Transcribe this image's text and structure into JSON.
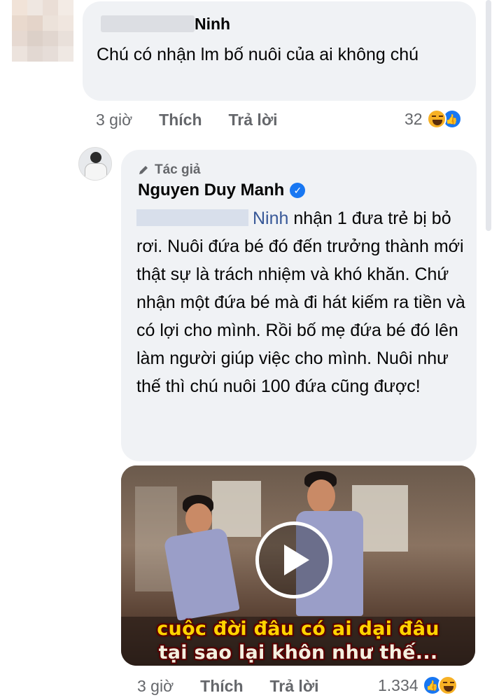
{
  "comment1": {
    "author_suffix": "Ninh",
    "text": "Chú có nhận lm bố nuôi của ai không chú",
    "time": "3 giờ",
    "like_label": "Thích",
    "reply_label": "Trả lời",
    "reaction_count": "32",
    "reaction_icons": [
      "haha-icon",
      "like-icon"
    ]
  },
  "reply": {
    "badge": "Tác giả",
    "author": "Nguyen Duy Manh",
    "verified": true,
    "mention": "Ninh",
    "text": "nhận 1 đưa trẻ bị bỏ rơi. Nuôi đứa bé đó đến trưởng thành mới thật sự là trách nhiệm và khó khăn. Chứ nhận một đứa bé mà đi hát kiếm ra tiền và có lợi cho mình. Rồi bố mẹ đứa bé đó lên làm người giúp việc cho mình. Nuôi như thế thì chú nuôi 100 đứa cũng được!",
    "video": {
      "subtitle_line1": "cuộc đời đâu có ai dại đâu",
      "subtitle_line2": "tại sao lại khôn như thế...",
      "play_icon": "play-icon"
    },
    "time": "3 giờ",
    "like_label": "Thích",
    "reply_label": "Trả lời",
    "reaction_count": "1.334",
    "reaction_icons": [
      "like-icon",
      "haha-icon"
    ]
  },
  "colors": {
    "bubble": "#f0f2f5",
    "meta_text": "#65676b",
    "mention": "#385898",
    "like_blue": "#1877f2",
    "haha_yellow": "#f7b125"
  }
}
